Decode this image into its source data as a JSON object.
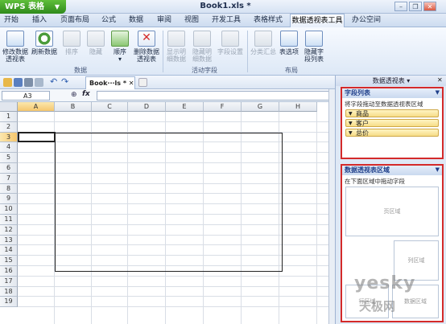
{
  "app": {
    "name": "WPS 表格",
    "doc_title": "Book1.xls *"
  },
  "menu": [
    "开始",
    "插入",
    "页面布局",
    "公式",
    "数据",
    "审阅",
    "视图",
    "开发工具",
    "表格样式",
    "数据透视表工具",
    "办公空间"
  ],
  "ribbon": {
    "buttons": [
      {
        "label1": "修改数据",
        "label2": "透视表",
        "icon": "edit-table-icon"
      },
      {
        "label1": "刷新数据",
        "label2": "",
        "icon": "refresh-icon"
      },
      {
        "label1": "排序",
        "label2": "",
        "icon": "sort-icon"
      },
      {
        "label1": "隐藏",
        "label2": "",
        "icon": "hide-icon"
      },
      {
        "label1": "顺序",
        "label2": "▾",
        "icon": "order-icon"
      },
      {
        "label1": "删除数据",
        "label2": "透视表",
        "icon": "delete-pivot-icon"
      },
      {
        "label1": "显示明",
        "label2": "细数据",
        "icon": "show-detail-icon"
      },
      {
        "label1": "隐藏明",
        "label2": "细数据",
        "icon": "hide-detail-icon"
      },
      {
        "label1": "字段设置",
        "label2": "",
        "icon": "field-settings-icon"
      },
      {
        "label1": "分类汇总",
        "label2": "",
        "icon": "subtotal-icon"
      },
      {
        "label1": "表选项",
        "label2": "",
        "icon": "table-options-icon"
      },
      {
        "label1": "隐藏字",
        "label2": "段列表",
        "icon": "hide-field-list-icon"
      }
    ],
    "groups": [
      "数据",
      "活动字段",
      "布局"
    ]
  },
  "toolbar": {
    "doc_tab": "Book···ls * ✕"
  },
  "formula": {
    "cell_ref": "A3",
    "fx": "fx"
  },
  "grid": {
    "columns": [
      "A",
      "B",
      "C",
      "D",
      "E",
      "F",
      "G",
      "H"
    ],
    "rows": [
      "1",
      "2",
      "3",
      "4",
      "5",
      "6",
      "7",
      "8",
      "9",
      "10",
      "11",
      "12",
      "13",
      "14",
      "15",
      "16",
      "17",
      "18",
      "19"
    ],
    "selected_cell": "A3"
  },
  "pane": {
    "title": "数据透视表 ▾",
    "field_list": {
      "header": "字段列表",
      "hint": "将字段拖动至数据透视表区域",
      "fields": [
        "商品",
        "客户",
        "总价"
      ]
    },
    "areas": {
      "header": "数据透视表区域",
      "hint": "在下面区域中拖动字段",
      "page": "页区域",
      "column": "列区域",
      "row": "行区域",
      "data": "数据区域"
    }
  },
  "watermark": {
    "line1": "yesky",
    "line2": "天极网"
  },
  "colors": {
    "highlight_border": "#d42a2a",
    "field_fill": "#f6dc86",
    "wps_green": "#3a9a22"
  }
}
